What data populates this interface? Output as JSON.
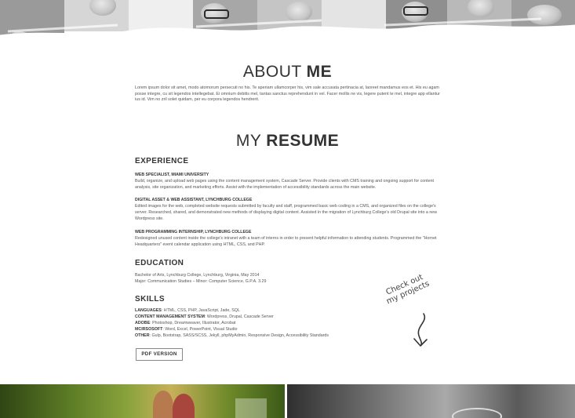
{
  "about": {
    "title_light": "ABOUT ",
    "title_bold": "ME",
    "body": "Lorem ipsum dolor sit amet, modo atomorum persecuti no his. Te aperiam ullamcorper his, vim sale accusata pertinacia at, laoreet mandamus eos et. His eu agam posse integre, cu sit legendos intellegebat. Ei omnium debitis mel, tantas sanctus reprehendunt in vel. Facer mollis ne vis, legere putent te mel, integre app ellantur ius id. Vim no zril solet quidam, per eu corpora legendos hendrerit."
  },
  "resume": {
    "title_light": "MY ",
    "title_bold": "RESUME",
    "experience": {
      "heading": "EXPERIENCE",
      "jobs": [
        {
          "title": "WEB SPECIALIST, MIAMI UNIVERSITY",
          "desc": "Build, organize, and upload web pages using the content management system, Cascade Server. Provide clients with CMS training and ongoing support for content analysis, site organization, and marketing efforts. Assist with the implementation of accessibility standards across the main website."
        },
        {
          "title": "DIGITAL ASSET & WEB ASSISTANT, LYNCHBURG COLLEGE",
          "desc": "Edited images for the web, completed website requests submitted by faculty and staff, programmed basic web coding in a CMS, and organized files on the college's server. Researched, shared, and demonstrated new methods of displaying digital content. Assisted in the migration of Lynchburg College's old Drupal site into a new Wordpress site."
        },
        {
          "title": "WEB PROGRAMMING INTERNSHIP, LYNCHBURG COLLEGE",
          "desc": "Redesigned unused content inside the college's intranet with a team of interns in order to present helpful information to attending students. Programmed the \"Hornet Headquarters\" event calendar application using HTML, CSS, and PHP."
        }
      ]
    },
    "education": {
      "heading": "EDUCATION",
      "lines": [
        "Bachelor of Arts, Lynchburg College, Lynchburg, Virginia, May 2014",
        "Major: Communication Studies – Minor: Computer Science, G.P.A. 3.29"
      ]
    },
    "skills": {
      "heading": "SKILLS",
      "items": [
        {
          "label": "LANGUAGES",
          "value": ": HTML, CSS, PHP, JavaScript, Jade, SQL"
        },
        {
          "label": "CONTENT MANAGEMENT SYSTEM",
          "value": ": Wordpress, Drupal, Cascade Server"
        },
        {
          "label": "ADOBE",
          "value": ": Photoshop, Dreamweaver, Illustrator, Acrobat"
        },
        {
          "label": "MCIRSOSOFT",
          "value": ": Word, Excel, PowerPoint, Visual Studio"
        },
        {
          "label": "OTHER",
          "value": ": Gulp, Bootstrap, SASS/SCSS, Jekyll, phpMyAdmin, Responsive Design, Accessibility Standards"
        }
      ]
    },
    "pdf_button": "PDF VERSION"
  },
  "projects_callout": {
    "line1": "Check out",
    "line2": "my projects"
  },
  "icons": {
    "arrow": "curved-down-arrow-icon"
  }
}
